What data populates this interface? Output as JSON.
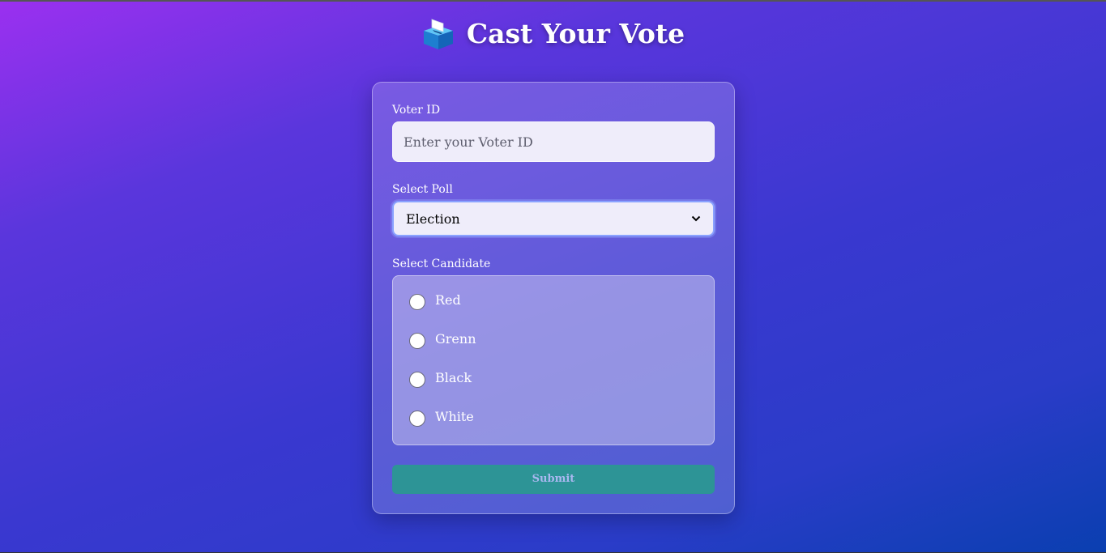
{
  "header": {
    "title": "Cast Your Vote",
    "icon": "ballot-box-icon"
  },
  "form": {
    "voter_id": {
      "label": "Voter ID",
      "value": "",
      "placeholder": "Enter your Voter ID"
    },
    "poll": {
      "label": "Select Poll",
      "selected": "Election"
    },
    "candidates": {
      "label": "Select Candidate",
      "options": [
        "Red",
        "Grenn",
        "Black",
        "White"
      ]
    },
    "submit_label": "Submit"
  },
  "colors": {
    "background_start": "#9b30f0",
    "background_end": "#0a3fb0",
    "submit_bg": "#2d9496",
    "submit_text": "#a9b8f0",
    "input_bg": "#efedfa",
    "select_focus_border": "#8aa2ff"
  }
}
